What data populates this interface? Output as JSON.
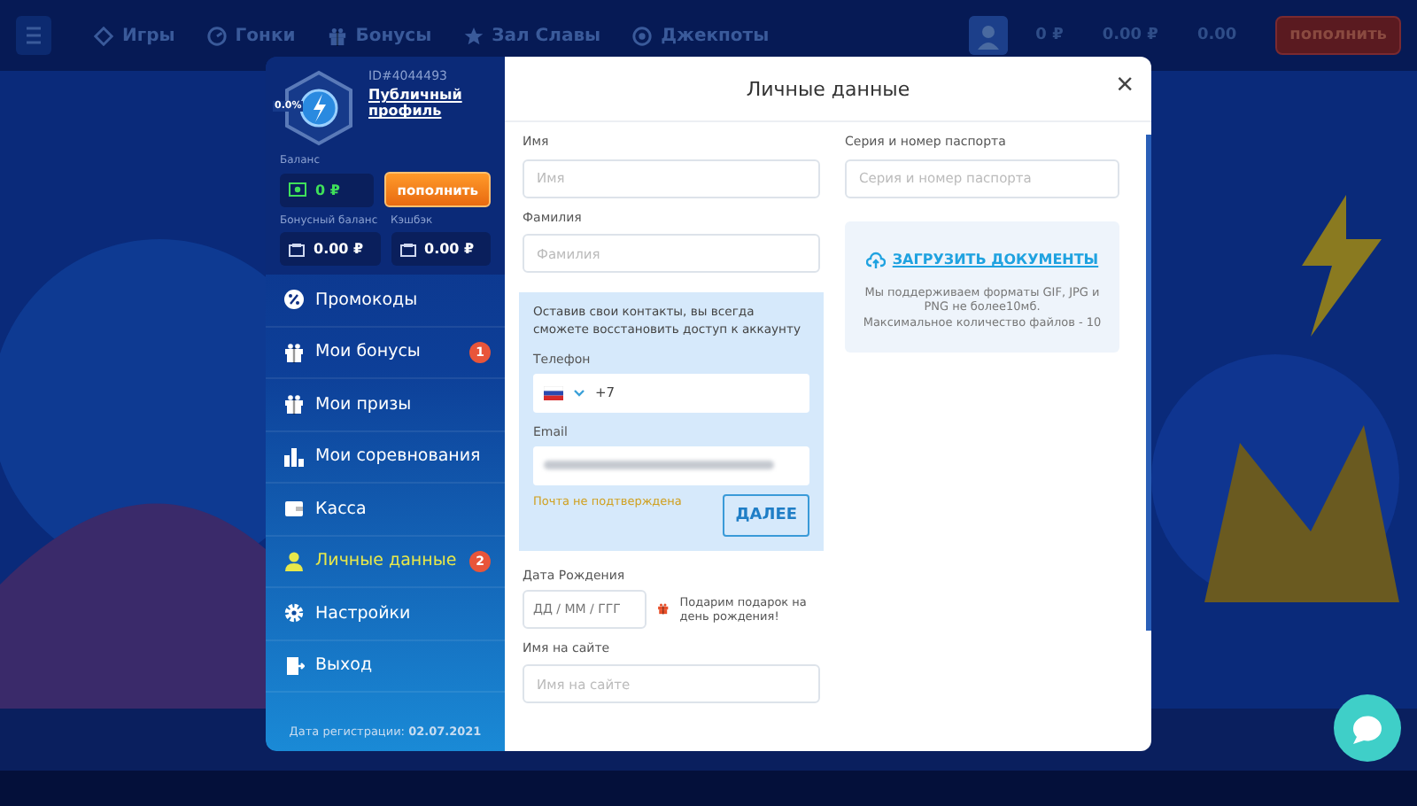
{
  "header": {
    "nav": [
      {
        "label": "Игры",
        "kind": "diamond"
      },
      {
        "label": "Гонки",
        "kind": "speed"
      },
      {
        "label": "Бонусы",
        "kind": "gift"
      },
      {
        "label": "Зал Славы",
        "kind": "star"
      },
      {
        "label": "Джекпоты",
        "kind": "coin"
      }
    ],
    "balances": [
      "0 ₽",
      "0.00 ₽",
      "0.00"
    ],
    "topup": "пополнить"
  },
  "sidebar": {
    "rank": "0.0%",
    "user_id": "ID#4044493",
    "profile_link": "Публичный профиль",
    "balance_label": "Баланс",
    "balance": "0 ₽",
    "topup": "пополнить",
    "bonus_label": "Бонусный баланс",
    "bonus": "0.00 ₽",
    "cashback_label": "Кэшбэк",
    "cashback": "0.00 ₽",
    "menu": [
      {
        "label": "Промокоды",
        "kind": "percent",
        "selected": false
      },
      {
        "label": "Мои бонусы",
        "kind": "gift",
        "selected": false,
        "badge": "1"
      },
      {
        "label": "Мои призы",
        "kind": "gift",
        "selected": false
      },
      {
        "label": "Мои соревнования",
        "kind": "chart",
        "selected": false
      },
      {
        "label": "Касса",
        "kind": "wallet",
        "selected": false
      },
      {
        "label": "Личные данные",
        "kind": "person",
        "selected": true,
        "badge": "2"
      },
      {
        "label": "Настройки",
        "kind": "gear",
        "selected": false
      },
      {
        "label": "Выход",
        "kind": "exit",
        "selected": false
      }
    ],
    "reg_label": "Дата регистрации:",
    "reg_date": "02.07.2021"
  },
  "form": {
    "title": "Личные данные",
    "close": "×",
    "first_name": {
      "label": "Имя",
      "placeholder": "Имя"
    },
    "last_name": {
      "label": "Фамилия",
      "placeholder": "Фамилия"
    },
    "contacts": {
      "note": "Оставив свои контакты, вы всегда сможете восстановить доступ к аккаунту",
      "phone_label": "Телефон",
      "phone_value": "+7",
      "email_label": "Email",
      "email_warning": "Почта не подтверждена",
      "next": "ДАЛЕЕ"
    },
    "birth": {
      "label": "Дата Рождения",
      "placeholder": "ДД / ММ / ГГГ",
      "gift_note": "Подарим подарок на день рождения!"
    },
    "site_name": {
      "label": "Имя на сайте",
      "placeholder": "Имя на сайте"
    },
    "passport": {
      "label": "Серия и номер паспорта",
      "placeholder": "Серия и номер паспорта"
    },
    "upload": {
      "button": "ЗАГРУЗИТЬ ДОКУМЕНТЫ",
      "hint": "Мы поддерживаем форматы GIF, JPG и PNG не более10мб.",
      "limit": "Максимальное количество файлов - 10"
    }
  }
}
